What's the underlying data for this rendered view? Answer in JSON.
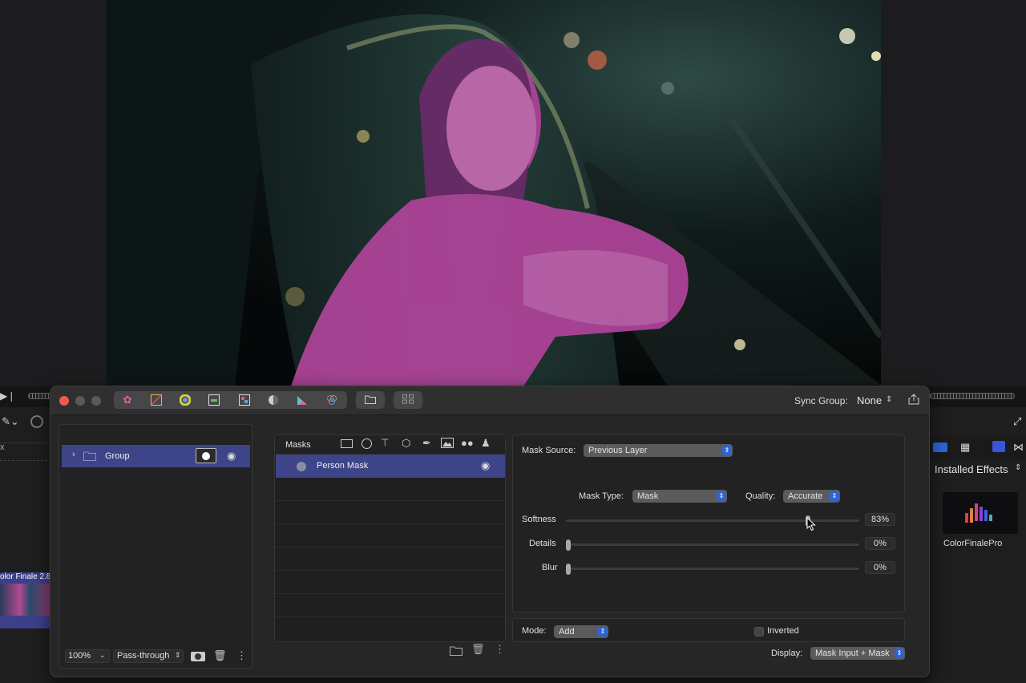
{
  "window": {
    "sync_group_label": "Sync Group:",
    "sync_group_value": "None"
  },
  "toolbar": {
    "tools": [
      "color-wheels-icon",
      "curves-icon",
      "color-wheel-icon",
      "levels-icon",
      "lut-icon",
      "sphere-icon",
      "histogram-icon",
      "selective-color-icon"
    ],
    "extra": [
      "folder-icon",
      "grid-icon"
    ]
  },
  "layers": {
    "group_label": "Group",
    "zoom": "100%",
    "blend": "Pass-through"
  },
  "masks": {
    "header": "Masks",
    "items": [
      {
        "label": "Person Mask"
      }
    ]
  },
  "mask_settings": {
    "source_label": "Mask Source:",
    "source_value": "Previous Layer",
    "type_label": "Mask Type:",
    "type_value": "Mask",
    "quality_label": "Quality:",
    "quality_value": "Accurate",
    "sliders": [
      {
        "label": "Softness",
        "value": "83%",
        "level": 0.83
      },
      {
        "label": "Details",
        "value": "0%",
        "level": 0
      },
      {
        "label": "Blur",
        "value": "0%",
        "level": 0
      }
    ],
    "mode_label": "Mode:",
    "mode_value": "Add",
    "inverted_label": "Inverted",
    "display_label": "Display:",
    "display_value": "Mask Input + Mask"
  },
  "host": {
    "installed_effects": "Installed Effects",
    "effect_name": "ColorFinalePro",
    "clip_label": "olor Finale 2.8"
  },
  "colors": {
    "accent": "#2d63d4",
    "selection": "#3d4588",
    "mask_overlay": "#b0449a"
  }
}
